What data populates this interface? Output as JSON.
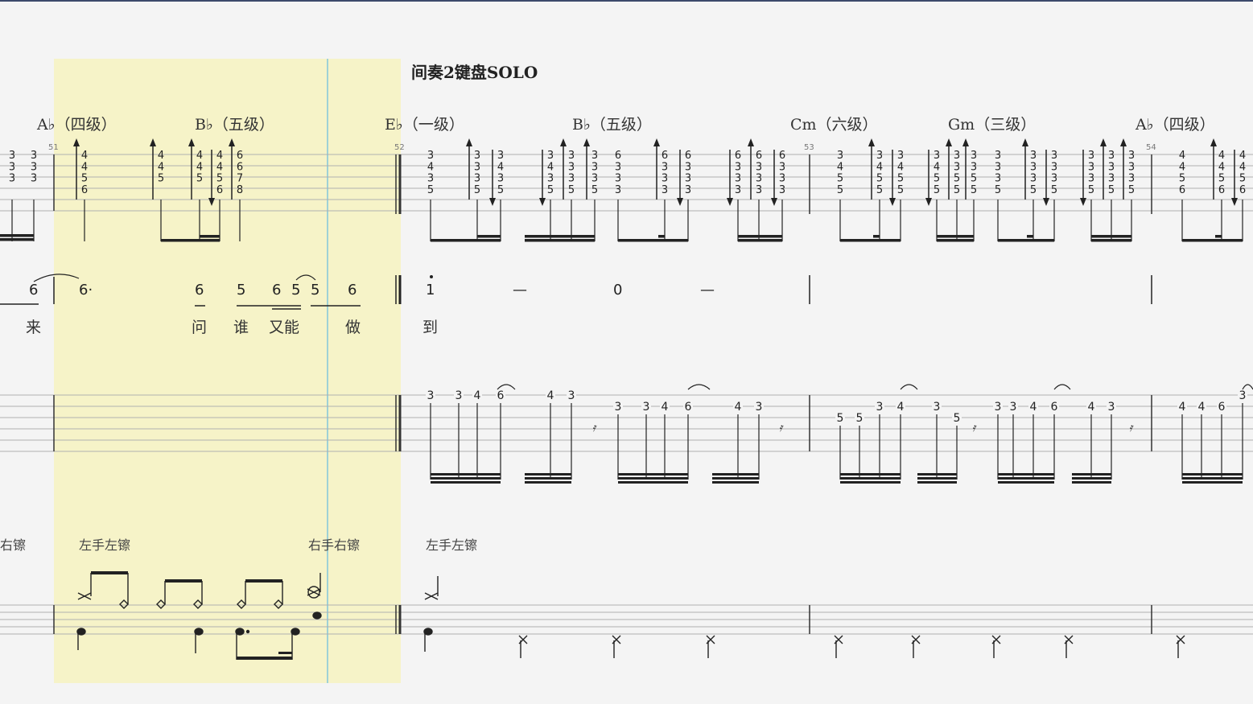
{
  "section_title": "间奏2键盘SOLO",
  "chords": [
    {
      "label": "A♭（四级）"
    },
    {
      "label": "B♭（五级）"
    },
    {
      "label": "E♭（一级）"
    },
    {
      "label": "B♭（五级）"
    },
    {
      "label": "Cm（六级）"
    },
    {
      "label": "Gm（三级）"
    },
    {
      "label": "A♭（四级）"
    }
  ],
  "measure_numbers": [
    "51",
    "52",
    "53",
    "54"
  ],
  "jianpu": {
    "notes": [
      "6",
      "6·",
      "6",
      "5",
      "6",
      "5",
      "5",
      "6",
      "1",
      "—",
      "0",
      "—"
    ],
    "lyrics": [
      "来",
      "问",
      "谁",
      "又能",
      "做",
      "到"
    ]
  },
  "percussion_labels": [
    "右镲",
    "左手左镲",
    "右手右镲",
    "左手左镲"
  ],
  "colors": {
    "highlight": "#f6f3c8",
    "cursor": "#9fd1d6",
    "staff_line": "#aaaaaa",
    "ink": "#222222"
  }
}
